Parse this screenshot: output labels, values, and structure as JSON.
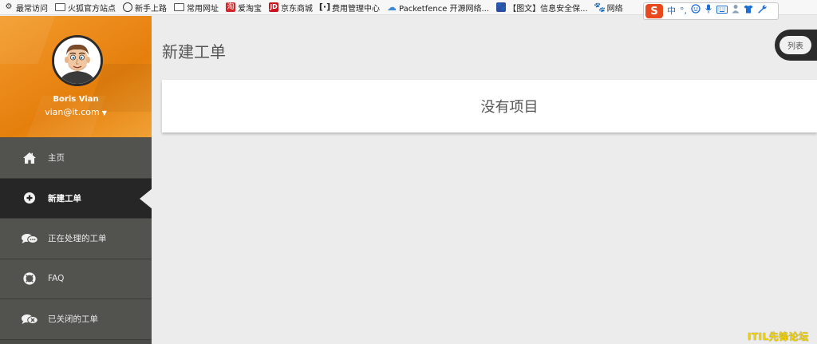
{
  "bookmarks": [
    {
      "label": "最常访问",
      "icon": "gear-icon"
    },
    {
      "label": "火狐官方站点",
      "icon": "folder-icon"
    },
    {
      "label": "新手上路",
      "icon": "globe-icon"
    },
    {
      "label": "常用网址",
      "icon": "folder-icon"
    },
    {
      "label": "爱淘宝",
      "icon": "taobao-icon"
    },
    {
      "label": "京东商城",
      "icon": "jd-icon"
    },
    {
      "label": "费用管理中心",
      "icon": "cost-icon"
    },
    {
      "label": "Packetfence 开源网络...",
      "icon": "cloud-icon"
    },
    {
      "label": "【图文】信息安全保...",
      "icon": "paw-icon"
    },
    {
      "label": "网络",
      "icon": "baidu-icon"
    }
  ],
  "ime": {
    "logo": "S",
    "mode": "中",
    "punct": "°,"
  },
  "profile": {
    "name": "Boris Vian",
    "email": "vian@it.com"
  },
  "menu": [
    {
      "label": "主页",
      "icon": "home-icon",
      "active": false
    },
    {
      "label": "新建工单",
      "icon": "plus-circle-icon",
      "active": true
    },
    {
      "label": "正在处理的工单",
      "icon": "chat-icon",
      "active": false
    },
    {
      "label": "FAQ",
      "icon": "lifebuoy-icon",
      "active": false
    },
    {
      "label": "已关闭的工单",
      "icon": "chat-closed-icon",
      "active": false
    }
  ],
  "main": {
    "title": "新建工单",
    "list_button": "列表",
    "empty_message": "没有项目"
  },
  "watermark": "ITIL先锋论坛",
  "colors": {
    "accent": "#eb8a1a",
    "sidebar": "#4a4a47",
    "active": "#262626",
    "background": "#ececec"
  }
}
